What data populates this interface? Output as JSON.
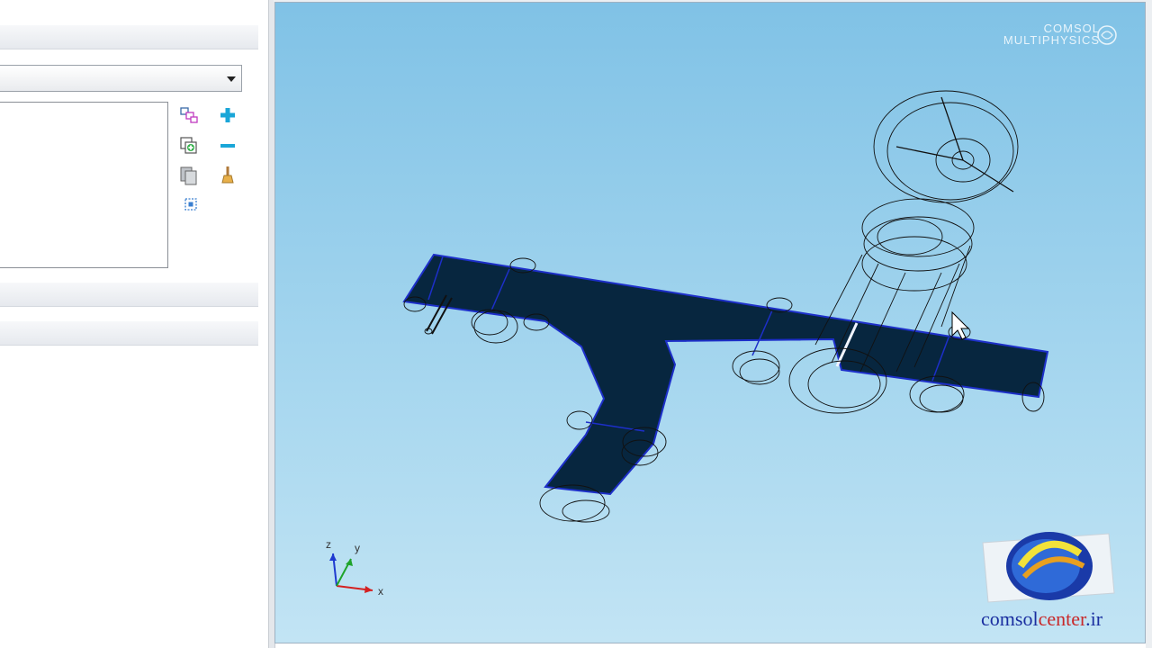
{
  "left_panel": {
    "combo": {
      "value": ""
    },
    "toolbar": [
      "select-objects-icon",
      "add-icon",
      "add-selection-icon",
      "remove-icon",
      "copy-icon",
      "clear-brush-icon",
      "zoom-selection-icon"
    ]
  },
  "viewport": {
    "brand_line1": "COMSOL",
    "brand_line2": "MULTIPHYSICS",
    "triad": {
      "z": "z",
      "y": "y",
      "x": "x"
    },
    "watermark": {
      "text_a": "comsol",
      "text_b": "center",
      "text_c": ".ir"
    }
  },
  "colors": {
    "viewport_top": "#80c2e6",
    "viewport_bottom": "#c2e4f4",
    "selected_fill": "#07263f",
    "selected_edge": "#1d2fc9",
    "wire": "#111111"
  }
}
